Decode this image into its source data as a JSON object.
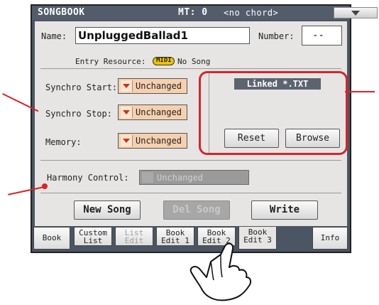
{
  "titlebar": {
    "name": "SONGBOOK",
    "mt": "MT: 0",
    "chord": "<no chord>"
  },
  "entry": {
    "name_label": "Name:",
    "name_value": "UnpluggedBallad1",
    "number_label": "Number:",
    "number_value": "--",
    "resource_label": "Entry Resource:",
    "resource_badge": "MIDI",
    "resource_value": "No Song"
  },
  "synchro": {
    "start_label": "Synchro Start:",
    "start_value": "Unchanged",
    "stop_label": "Synchro Stop:",
    "stop_value": "Unchanged",
    "memory_label": "Memory:",
    "memory_value": "Unchanged"
  },
  "linked": {
    "title": "Linked *.TXT",
    "reset_label": "Reset",
    "browse_label": "Browse"
  },
  "harmony": {
    "label": "Harmony Control:",
    "value": "Unchanged"
  },
  "actions": {
    "new_song": "New Song",
    "del_song": "Del Song",
    "write": "Write"
  },
  "tabs": {
    "book": "Book",
    "custom_list_1": "Custom",
    "custom_list_2": "List",
    "list_edit_1": "List",
    "list_edit_2": "Edit",
    "book_edit1_1": "Book",
    "book_edit1_2": "Edit 1",
    "book_edit2_1": "Book",
    "book_edit2_2": "Edit 2",
    "book_edit3_1": "Book",
    "book_edit3_2": "Edit 3",
    "info": "Info"
  },
  "colors": {
    "frame": "#4c5563",
    "panel": "#e7e5e3",
    "dropdown": "#f6d0ae",
    "highlight": "#d8232a"
  }
}
